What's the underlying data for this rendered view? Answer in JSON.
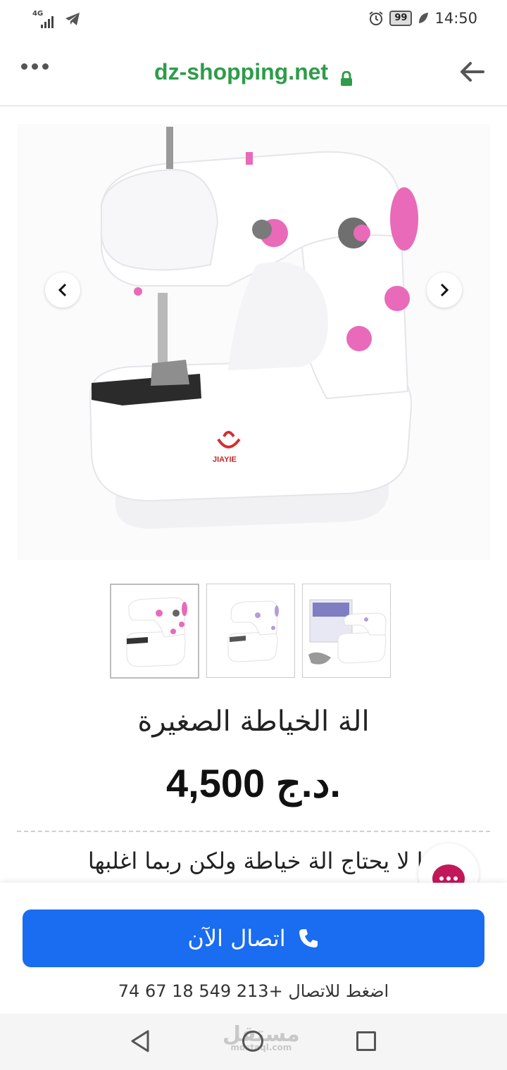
{
  "status_bar": {
    "network": "4G",
    "battery": "99",
    "time": "14:50"
  },
  "browser": {
    "url": "dz-shopping.net"
  },
  "product": {
    "image_brand": "JIAYIE",
    "title": "الة الخياطة الصغيرة",
    "price": "4,500 د.ج.",
    "description": "من منا لا يحتاج الة خياطة ولكن ربما اغلبها"
  },
  "cta": {
    "call_label": "اتصال الآن",
    "call_hint": "اضغط للاتصال +213 549 18 67 74"
  },
  "watermark": {
    "text": "مستقل",
    "sub": "mostaql.com"
  },
  "colors": {
    "url_green": "#2e9c4a",
    "call_blue": "#1a6cf0",
    "chat_pink": "#c2185b",
    "machine_pink": "#e86ab8"
  }
}
